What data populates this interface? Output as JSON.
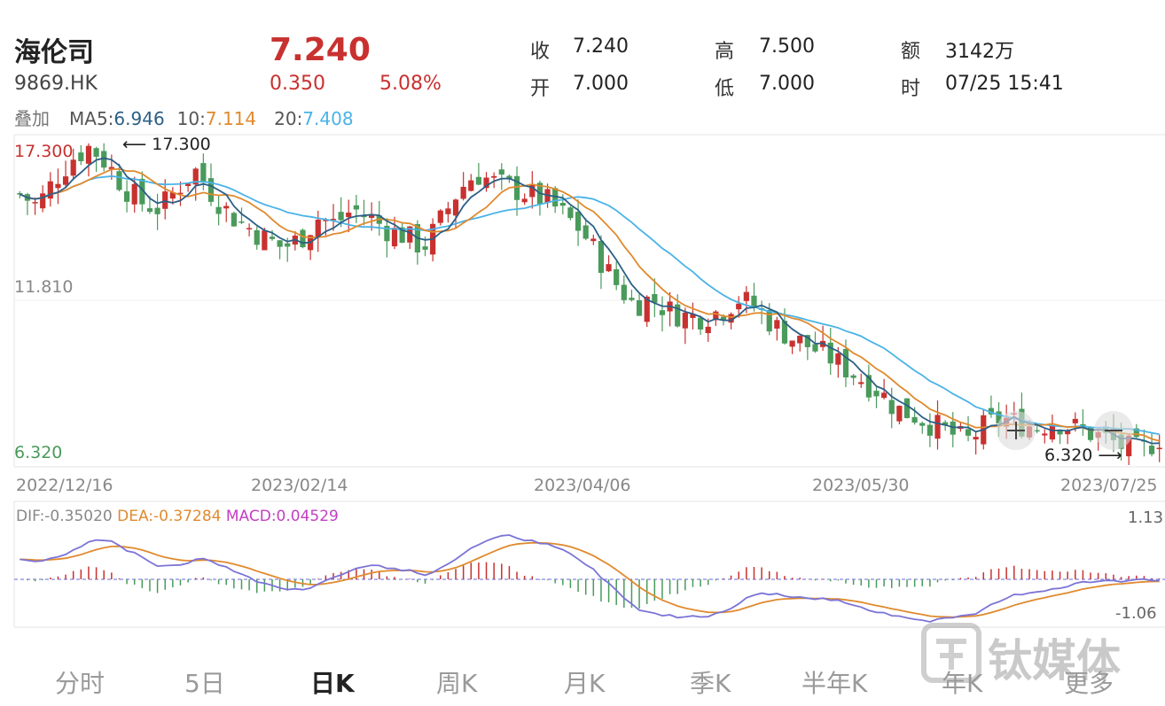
{
  "stock": {
    "name": "海伦司",
    "code": "9869.HK",
    "price": "7.240",
    "change": "0.350",
    "change_pct": "5.08%"
  },
  "quote": {
    "close_label": "收",
    "close": "7.240",
    "open_label": "开",
    "open": "7.000",
    "high_label": "高",
    "high": "7.500",
    "low_label": "低",
    "low": "7.000",
    "amount_label": "额",
    "amount": "3142万",
    "time_label": "时",
    "time": "07/25 15:41"
  },
  "overlay": {
    "label": "叠加",
    "ma5_label": "MA5:",
    "ma5": "6.946",
    "ma10_label": "10:",
    "ma10": "7.114",
    "ma20_label": "20:",
    "ma20": "7.408"
  },
  "colors": {
    "up": "#c8312f",
    "down": "#4a9a5b",
    "ma5": "#2b5f86",
    "ma10": "#e08a2e",
    "ma20": "#4ab3e6",
    "dif": "#7b74d6",
    "dea": "#e08a2e",
    "macd": "#c23fc2"
  },
  "kline": {
    "y_top_label": "17.300",
    "y_mid_label": "11.810",
    "y_bottom_label": "6.320",
    "max_marker": "17.300",
    "min_marker": "6.320",
    "dates": [
      "2022/12/16",
      "2023/02/14",
      "2023/04/06",
      "2023/05/30",
      "2023/07/25"
    ]
  },
  "macd": {
    "dif_label": "DIF:-0.35020",
    "dea_label": "DEA:-0.37284",
    "macd_label": "MACD:0.04529",
    "max_label": "1.13",
    "min_label": "-1.06"
  },
  "tabs": [
    {
      "label": "分时",
      "active": false
    },
    {
      "label": "5日",
      "active": false
    },
    {
      "label": "日K",
      "active": true
    },
    {
      "label": "周K",
      "active": false
    },
    {
      "label": "月K",
      "active": false
    },
    {
      "label": "季K",
      "active": false
    },
    {
      "label": "半年K",
      "active": false
    },
    {
      "label": "年K",
      "active": false
    },
    {
      "label": "更多",
      "active": false
    }
  ],
  "watermark": "钛媒体",
  "chart_data": [
    {
      "type": "candlestick",
      "title": "",
      "x_ticks": [
        "2022/12/16",
        "2023/02/14",
        "2023/04/06",
        "2023/05/30",
        "2023/07/25"
      ],
      "ylim": [
        6.32,
        17.3
      ],
      "y_ticks": [
        17.3,
        11.81,
        6.32
      ],
      "grid": true,
      "series": [
        {
          "name": "MA5",
          "latest": 6.946
        },
        {
          "name": "10",
          "latest": 7.114
        },
        {
          "name": "20",
          "latest": 7.408
        }
      ],
      "close_path": [
        15.4,
        15.0,
        15.9,
        16.6,
        17.0,
        16.4,
        15.6,
        15.1,
        14.9,
        15.6,
        16.2,
        15.4,
        14.7,
        14.3,
        13.9,
        13.6,
        13.9,
        14.6,
        14.4,
        14.9,
        14.6,
        14.2,
        14.0,
        13.6,
        14.5,
        15.5,
        16.1,
        15.8,
        15.6,
        15.4,
        15.2,
        14.7,
        14.2,
        13.3,
        12.4,
        11.7,
        11.9,
        11.5,
        11.3,
        11.3,
        11.5,
        11.9,
        11.6,
        11.0,
        10.6,
        10.3,
        10.0,
        9.6,
        9.2,
        8.8,
        8.2,
        8.0,
        7.7,
        7.4,
        7.1,
        7.6,
        7.9,
        7.7,
        7.6,
        7.8,
        7.6,
        7.4,
        7.2,
        6.9,
        6.8,
        7.24
      ],
      "candle_count": 150
    },
    {
      "type": "macd",
      "ylim": [
        -1.06,
        1.13
      ],
      "dif": -0.3502,
      "dea": -0.37284,
      "macd": 0.04529
    }
  ]
}
